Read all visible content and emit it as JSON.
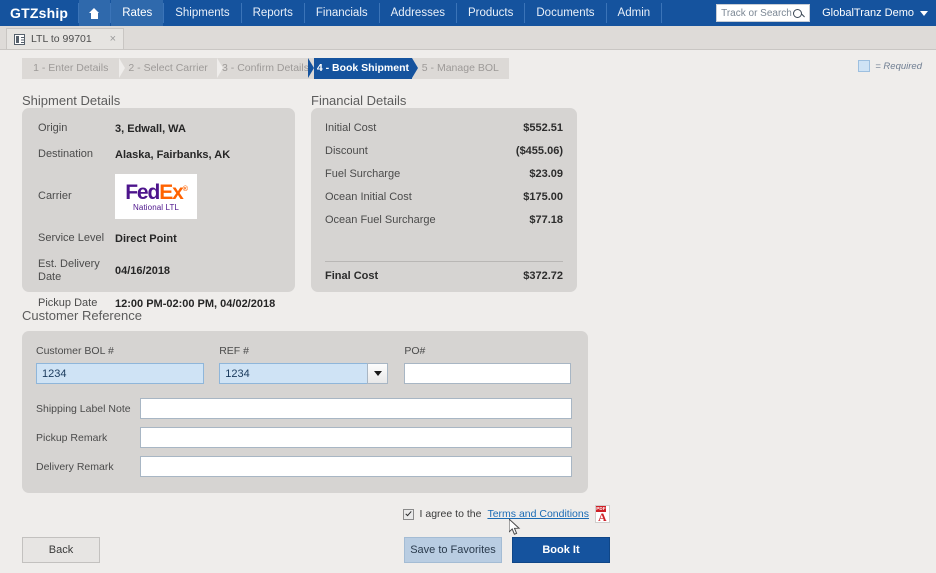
{
  "topnav": {
    "brand": "GTZship",
    "home_icon": "home-icon",
    "items": [
      {
        "label": "Rates",
        "active": true
      },
      {
        "label": "Shipments",
        "active": false
      },
      {
        "label": "Reports",
        "active": false
      },
      {
        "label": "Financials",
        "active": false
      },
      {
        "label": "Addresses",
        "active": false
      },
      {
        "label": "Products",
        "active": false
      },
      {
        "label": "Documents",
        "active": false
      },
      {
        "label": "Admin",
        "active": false
      }
    ],
    "search_placeholder": "Track or Search",
    "search_value": "",
    "search_icon": "search-icon",
    "user": "GlobalTranz Demo",
    "accent": "#15539e"
  },
  "doctab": {
    "label": "LTL to 99701",
    "icon": "document-list-icon",
    "close": "×"
  },
  "steps": [
    {
      "label": "1 - Enter Details",
      "active": false
    },
    {
      "label": "2 - Select Carrier",
      "active": false
    },
    {
      "label": "3 - Confirm Details",
      "active": false
    },
    {
      "label": "4 - Book Shipment",
      "active": true
    },
    {
      "label": "5 - Manage BOL",
      "active": false
    }
  ],
  "legend": {
    "text": "= Required",
    "swatch_color": "#cfe3f5"
  },
  "shipment": {
    "title": "Shipment Details",
    "rows": [
      {
        "label": "Origin",
        "value": "3, Edwall, WA"
      },
      {
        "label": "Destination",
        "value": "Alaska, Fairbanks, AK"
      },
      {
        "label": "Carrier",
        "value": ""
      },
      {
        "label": "Service Level",
        "value": "Direct Point"
      },
      {
        "label": "Est. Delivery Date",
        "value": "04/16/2018"
      },
      {
        "label": "Pickup Date",
        "value": "12:00 PM-02:00 PM, 04/02/2018"
      }
    ],
    "carrier_logo": {
      "fed": "Fed",
      "ex": "Ex",
      "registered": "®",
      "sub": "National LTL",
      "fed_color": "#4d148c",
      "ex_color": "#ff6200"
    }
  },
  "financial": {
    "title": "Financial Details",
    "rows": [
      {
        "label": "Initial Cost",
        "value": "$552.51"
      },
      {
        "label": "Discount",
        "value": "($455.06)"
      },
      {
        "label": "Fuel Surcharge",
        "value": "$23.09"
      },
      {
        "label": "Ocean Initial Cost",
        "value": "$175.00"
      },
      {
        "label": "Ocean Fuel Surcharge",
        "value": "$77.18"
      }
    ],
    "total": {
      "label": "Final Cost",
      "value": "$372.72"
    }
  },
  "customer_reference": {
    "title": "Customer Reference",
    "bol": {
      "label": "Customer BOL #",
      "value": "1234",
      "required": true
    },
    "ref": {
      "label": "REF #",
      "value": "1234",
      "required": true
    },
    "po": {
      "label": "PO#",
      "value": "",
      "required": false
    },
    "rows": [
      {
        "label": "Shipping Label Note",
        "value": ""
      },
      {
        "label": "Pickup Remark",
        "value": ""
      },
      {
        "label": "Delivery Remark",
        "value": ""
      }
    ]
  },
  "agreement": {
    "checked": true,
    "text": "I agree to the",
    "link": "Terms and Conditions",
    "pdf_badge": "PDF",
    "pdf_glyph": "A"
  },
  "buttons": {
    "back": "Back",
    "save_favorites": "Save to Favorites",
    "book": "Book It"
  }
}
